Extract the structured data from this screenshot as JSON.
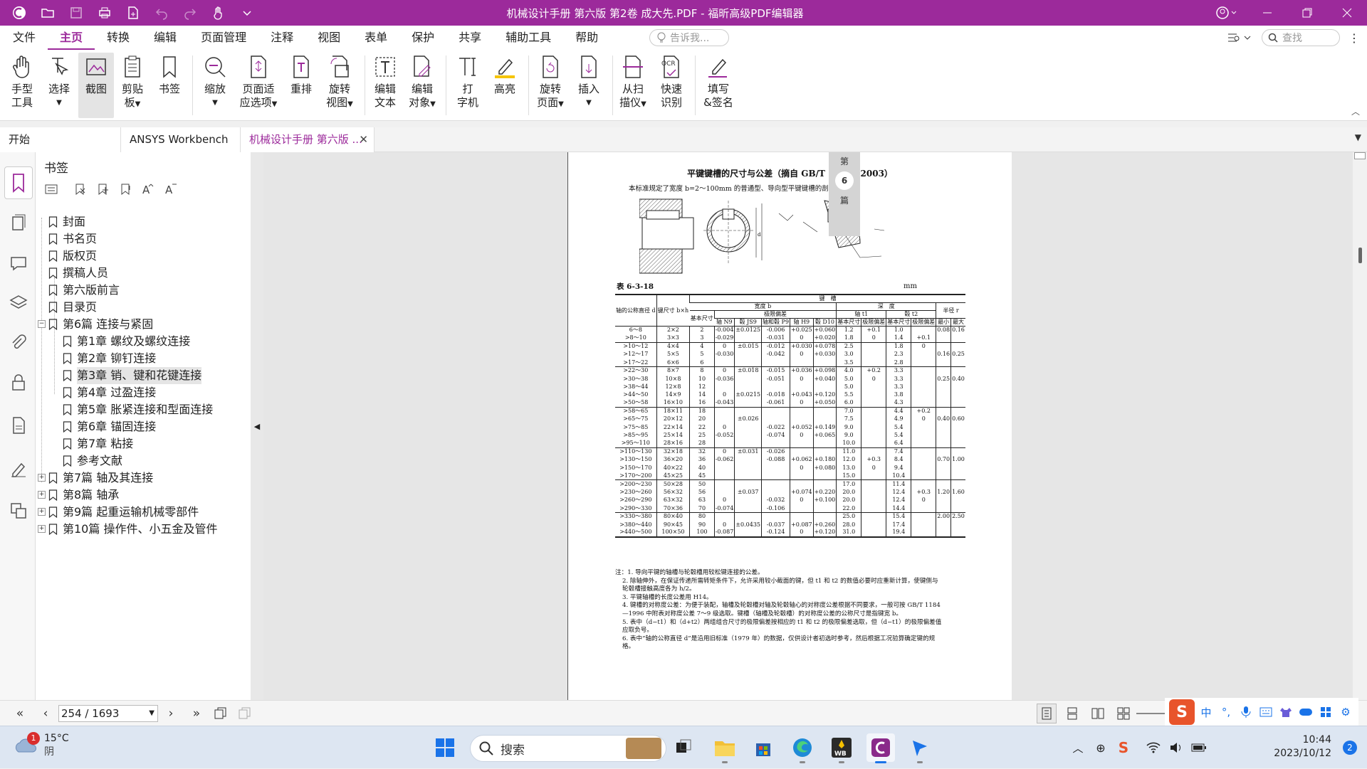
{
  "app": {
    "title": "机械设计手册 第六版 第2卷 成大先.PDF - 福昕高级PDF编辑器"
  },
  "menu": {
    "items": [
      "文件",
      "主页",
      "转换",
      "编辑",
      "页面管理",
      "注释",
      "视图",
      "表单",
      "保护",
      "共享",
      "辅助工具",
      "帮助"
    ],
    "active": "主页",
    "tellme_placeholder": "告诉我...",
    "find_placeholder": "查找"
  },
  "ribbon": {
    "hand": [
      "手型",
      "工具"
    ],
    "select": "选择",
    "snapshot": "截图",
    "clipboard": [
      "剪贴",
      "板"
    ],
    "bookmark": "书签",
    "zoom": "缩放",
    "fit": [
      "页面适",
      "应选项"
    ],
    "reflow": "重排",
    "rotate_view": [
      "旋转",
      "视图"
    ],
    "edit_text": [
      "编辑",
      "文本"
    ],
    "edit_object": [
      "编辑",
      "对象"
    ],
    "typewriter": [
      "打",
      "字机"
    ],
    "highlight": "高亮",
    "rotate_page": [
      "旋转",
      "页面"
    ],
    "insert": "插入",
    "from_scanner": [
      "从扫",
      "描仪"
    ],
    "ocr": [
      "快速",
      "识别"
    ],
    "fill_sign": [
      "填写",
      "&签名"
    ]
  },
  "tabs": [
    {
      "label": "开始"
    },
    {
      "label": "ANSYS Workbench有..."
    },
    {
      "label": "机械设计手册 第六版 ..."
    }
  ],
  "bookmarks": {
    "title": "书签",
    "items": [
      {
        "label": "封面"
      },
      {
        "label": "书名页"
      },
      {
        "label": "版权页"
      },
      {
        "label": "撰稿人员"
      },
      {
        "label": "第六版前言"
      },
      {
        "label": "目录页"
      },
      {
        "label": "第6篇  连接与紧固"
      },
      {
        "label": "第1章  螺纹及螺纹连接"
      },
      {
        "label": "第2章  铆钉连接"
      },
      {
        "label": "第3章  销、键和花键连接"
      },
      {
        "label": "第4章  过盈连接"
      },
      {
        "label": "第5章  胀紧连接和型面连接"
      },
      {
        "label": "第6章  锚固连接"
      },
      {
        "label": "第7章  粘接"
      },
      {
        "label": "参考文献"
      },
      {
        "label": "第7篇  轴及其连接"
      },
      {
        "label": "第8篇  轴承"
      },
      {
        "label": "第9篇  起重运输机械零部件"
      },
      {
        "label": "第10篇  操作件、小五金及管件"
      }
    ]
  },
  "document": {
    "chapter_mark": [
      "第",
      "6",
      "篇"
    ],
    "title": "平键键槽的尺寸与公差（摘自 GB/T 1095—2003）",
    "intro": "本标准规定了宽度 b=2～100mm 的普通型、导向型平键键槽的剖面尺寸",
    "table_label": "表 6-3-18",
    "unit": "mm",
    "headers": {
      "col1": "轴的公称直径 d",
      "col2": "键尺寸 b×h",
      "keyslot": "键　槽",
      "width": "宽度 b",
      "basic_size": "基本尺寸",
      "limit_dev": "极限偏差",
      "normal": "正常连接",
      "tight": "紧密连接",
      "loose": "松连接",
      "shaft_n9": "轴 N9",
      "hub_js9": "毂 JS9",
      "both_p9": "轴和毂 P9",
      "shaft_h9": "轴 H9",
      "hub_d10": "毂 D10",
      "depth": "深　度",
      "shaft_t1": "轴 t1",
      "hub_t2": "毂 t2",
      "depth_basic": "基本尺寸",
      "depth_dev": "极限偏差",
      "radius": "半径 r",
      "min": "最小",
      "max": "最大"
    },
    "rows": [
      [
        "6～8",
        "2×2",
        "2",
        "-0.004",
        "±0.0125",
        "-0.006",
        "+0.025",
        "+0.060",
        "1.2",
        "+0.1",
        "1.0",
        "",
        "0.08",
        "0.16"
      ],
      [
        ">8～10",
        "3×3",
        "3",
        "-0.029",
        "",
        "-0.031",
        "0",
        "+0.020",
        "1.8",
        "0",
        "1.4",
        "+0.1",
        "",
        ""
      ],
      [
        ">10～12",
        "4×4",
        "4",
        "0",
        "±0.015",
        "-0.012",
        "+0.030",
        "+0.078",
        "2.5",
        "",
        "1.8",
        "0",
        "",
        ""
      ],
      [
        ">12～17",
        "5×5",
        "5",
        "-0.030",
        "",
        "-0.042",
        "0",
        "+0.030",
        "3.0",
        "",
        "2.3",
        "",
        "0.16",
        "0.25"
      ],
      [
        ">17～22",
        "6×6",
        "6",
        "",
        "",
        "",
        "",
        "",
        "3.5",
        "",
        "2.8",
        "",
        "",
        ""
      ],
      [
        ">22～30",
        "8×7",
        "8",
        "0",
        "±0.018",
        "-0.015",
        "+0.036",
        "+0.098",
        "4.0",
        "+0.2",
        "3.3",
        "",
        "",
        ""
      ],
      [
        ">30～38",
        "10×8",
        "10",
        "-0.036",
        "",
        "-0.051",
        "0",
        "+0.040",
        "5.0",
        "0",
        "3.3",
        "",
        "0.25",
        "0.40"
      ],
      [
        ">38～44",
        "12×8",
        "12",
        "",
        "",
        "",
        "",
        "",
        "5.0",
        "",
        "3.3",
        "",
        "",
        ""
      ],
      [
        ">44～50",
        "14×9",
        "14",
        "0",
        "±0.0215",
        "-0.018",
        "+0.043",
        "+0.120",
        "5.5",
        "",
        "3.8",
        "",
        "",
        ""
      ],
      [
        ">50～58",
        "16×10",
        "16",
        "-0.043",
        "",
        "-0.061",
        "0",
        "+0.050",
        "6.0",
        "",
        "4.3",
        "",
        "",
        ""
      ],
      [
        ">58～65",
        "18×11",
        "18",
        "",
        "",
        "",
        "",
        "",
        "7.0",
        "",
        "4.4",
        "+0.2",
        "",
        ""
      ],
      [
        ">65～75",
        "20×12",
        "20",
        "",
        "±0.026",
        "",
        "",
        "",
        "7.5",
        "",
        "4.9",
        "0",
        "0.40",
        "0.60"
      ],
      [
        ">75～85",
        "22×14",
        "22",
        "0",
        "",
        "-0.022",
        "+0.052",
        "+0.149",
        "9.0",
        "",
        "5.4",
        "",
        "",
        ""
      ],
      [
        ">85～95",
        "25×14",
        "25",
        "-0.052",
        "",
        "-0.074",
        "0",
        "+0.065",
        "9.0",
        "",
        "5.4",
        "",
        "",
        ""
      ],
      [
        ">95～110",
        "28×16",
        "28",
        "",
        "",
        "",
        "",
        "",
        "10.0",
        "",
        "6.4",
        "",
        "",
        ""
      ],
      [
        ">110～130",
        "32×18",
        "32",
        "0",
        "±0.031",
        "-0.026",
        "",
        "",
        "11.0",
        "",
        "7.4",
        "",
        "",
        ""
      ],
      [
        ">130～150",
        "36×20",
        "36",
        "-0.062",
        "",
        "-0.088",
        "+0.062",
        "+0.180",
        "12.0",
        "+0.3",
        "8.4",
        "",
        "0.70",
        "1.00"
      ],
      [
        ">150～170",
        "40×22",
        "40",
        "",
        "",
        "",
        "0",
        "+0.080",
        "13.0",
        "0",
        "9.4",
        "",
        "",
        ""
      ],
      [
        ">170～200",
        "45×25",
        "45",
        "",
        "",
        "",
        "",
        "",
        "15.0",
        "",
        "10.4",
        "",
        "",
        ""
      ],
      [
        ">200～230",
        "50×28",
        "50",
        "",
        "",
        "",
        "",
        "",
        "17.0",
        "",
        "11.4",
        "",
        "",
        ""
      ],
      [
        ">230～260",
        "56×32",
        "56",
        "",
        "±0.037",
        "",
        "+0.074",
        "+0.220",
        "20.0",
        "",
        "12.4",
        "+0.3",
        "1.20",
        "1.60"
      ],
      [
        ">260～290",
        "63×32",
        "63",
        "0",
        "",
        "-0.032",
        "0",
        "+0.100",
        "20.0",
        "",
        "12.4",
        "0",
        "",
        ""
      ],
      [
        ">290～330",
        "70×36",
        "70",
        "-0.074",
        "",
        "-0.106",
        "",
        "",
        "22.0",
        "",
        "14.4",
        "",
        "",
        ""
      ],
      [
        ">330～380",
        "80×40",
        "80",
        "",
        "",
        "",
        "",
        "",
        "25.0",
        "",
        "15.4",
        "",
        "2.00",
        "2.50"
      ],
      [
        ">380～440",
        "90×45",
        "90",
        "0",
        "±0.0435",
        "-0.037",
        "+0.087",
        "+0.260",
        "28.0",
        "",
        "17.4",
        "",
        "",
        ""
      ],
      [
        ">440～500",
        "100×50",
        "100",
        "-0.087",
        "",
        "-0.124",
        "0",
        "+0.120",
        "31.0",
        "",
        "19.4",
        "",
        "",
        ""
      ]
    ],
    "notes": [
      "注：1. 导向平键的轴槽与轮毂槽用较松键连接的公差。",
      "2. 除轴伸外，在保证传递所需转矩条件下，允许采用较小截面的键，但 t1 和 t2 的数值必要时应重新计算，使键侧与轮毂槽接触高度各为 h/2。",
      "3. 平键轴槽的长度公差用 H14。",
      "4. 键槽的对称度公差：为便于装配，轴槽及轮毂槽对轴及轮毂轴心的对称度公差根据不同要求，一般可按 GB/T 1184—1996 中附表对称度公差 7～9 级选取。键槽（轴槽及轮毂槽）的对称度公差的公称尺寸是指键宽 b。",
      "5. 表中（d−t1）和（d+t2）两组组合尺寸的极限偏差按相应的 t1 和 t2 的极限偏差选取，但（d−t1）的极限偏差值应取负号。",
      "6. 表中“轴的公称直径 d”是沿用旧标准（1979 年）的数据，仅供设计者初选时参考，然后根据工况验算确定键的规格。"
    ]
  },
  "statusbar": {
    "page": "254 / 1693"
  },
  "taskbar": {
    "weather_temp": "15°C",
    "weather_desc": "阴",
    "weather_badge": "1",
    "search_placeholder": "搜索",
    "ime_lang": "中",
    "clock_time": "10:44",
    "clock_date": "2023/10/12",
    "notif_count": "2"
  },
  "colors": {
    "brand": "#9c2a9b",
    "accent": "#1a73e8"
  }
}
